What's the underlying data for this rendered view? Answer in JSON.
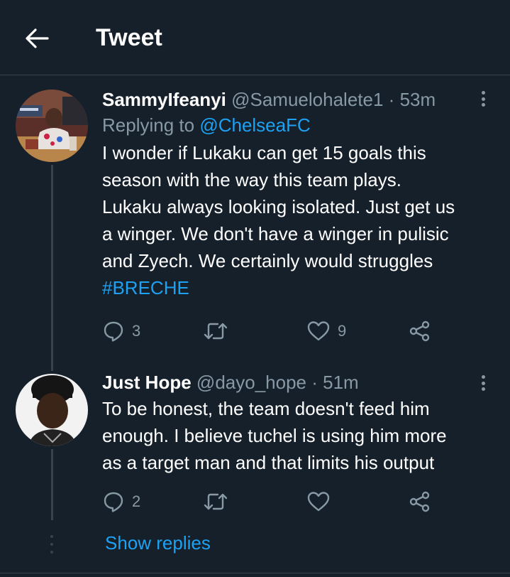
{
  "header": {
    "title": "Tweet"
  },
  "tweets": [
    {
      "name": "SammyIfeanyi",
      "handle": "@Samuelohalete1",
      "sep": "·",
      "time": "53m",
      "replying_label": "Replying to",
      "replying_to": "@ChelseaFC",
      "lines": [
        "I wonder if Lukaku can get 15 goals this",
        "season with the way this team plays.",
        "Lukaku always looking isolated. Just get us",
        "a winger. We don't have a winger in pulisic",
        "and Zyech. We certainly would struggles"
      ],
      "hashtag": "#BRECHE",
      "replies": "3",
      "retweets": "",
      "likes": "9"
    },
    {
      "name": "Just Hope",
      "handle": "@dayo_hope",
      "sep": "·",
      "time": "51m",
      "lines": [
        "To be honest, the team doesn't feed him",
        "enough. I believe tuchel is using him more",
        "as a target man and that limits his output"
      ],
      "replies": "2",
      "retweets": "",
      "likes": ""
    }
  ],
  "show_replies": "Show replies",
  "colors": {
    "background": "#15202b",
    "border": "#38444d",
    "secondary_text": "#8899a6",
    "accent": "#1da1f2"
  },
  "icons": {
    "back": "arrow-left-icon",
    "more": "more-vertical-icon",
    "reply": "comment-icon",
    "retweet": "retweet-icon",
    "like": "heart-icon",
    "share": "share-icon"
  }
}
